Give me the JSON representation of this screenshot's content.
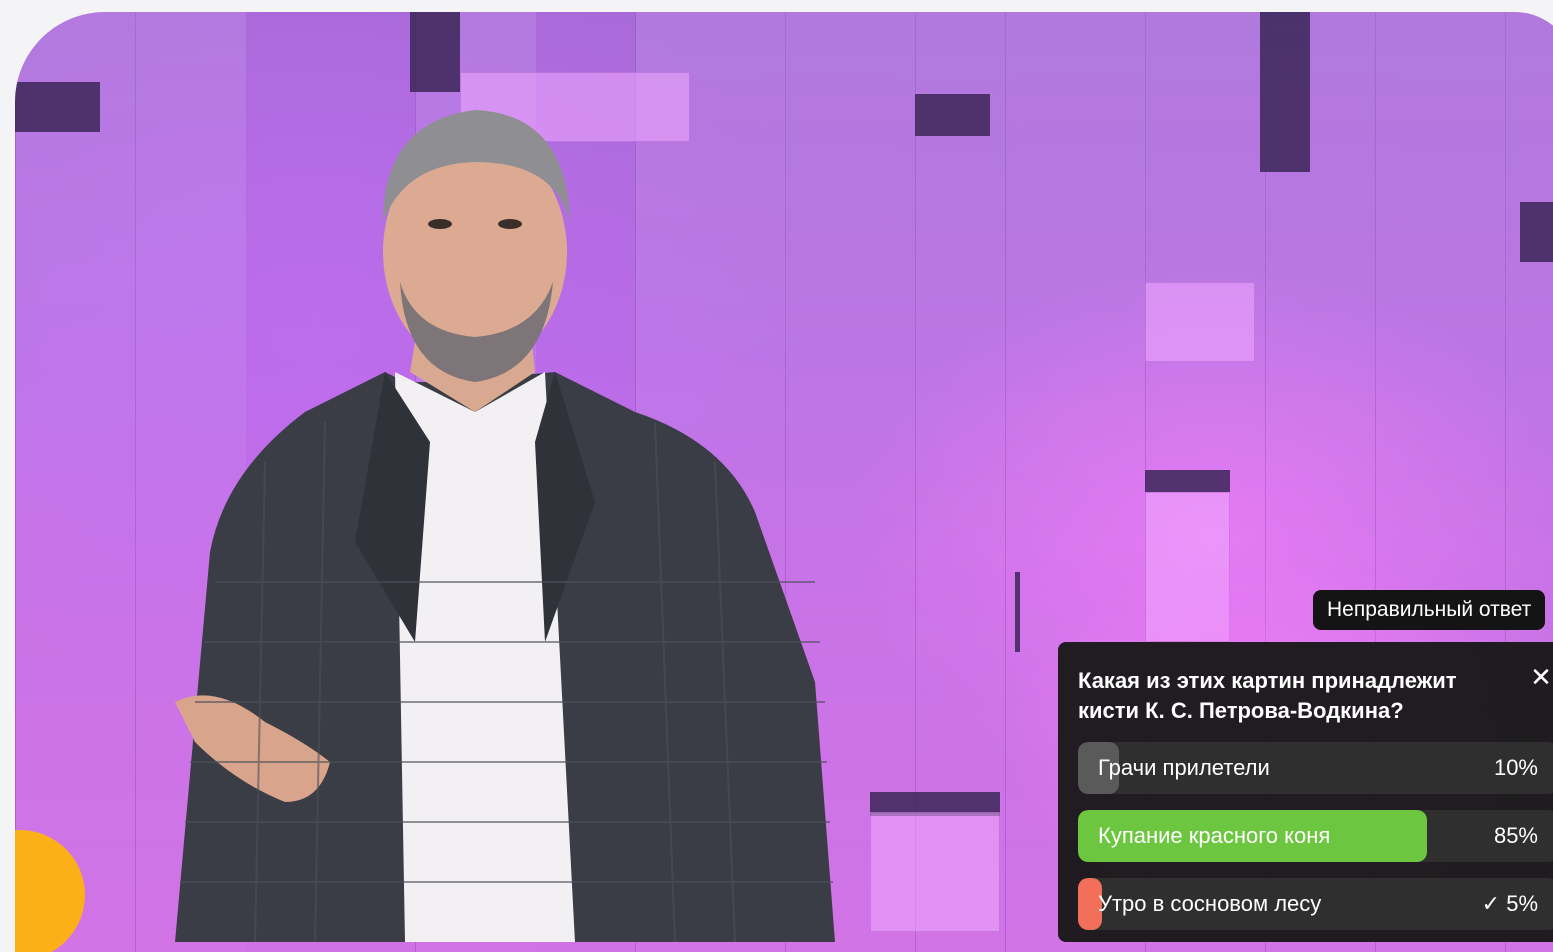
{
  "overlay": {
    "badge_text": "Неправильный ответ"
  },
  "quiz": {
    "question": "Какая из этих картин принадлежит кисти К. С. Петрова-Водкина?",
    "close_icon": "✕",
    "options": [
      {
        "label": "Грачи прилетели",
        "percent": "10%",
        "share": 0.1,
        "color": "#5a5a5a",
        "checked": false
      },
      {
        "label": "Купание красного коня",
        "percent": "85%",
        "share": 0.85,
        "color": "#6cc63f",
        "checked": false
      },
      {
        "label": "Утро в сосновом лесу",
        "percent": "5%",
        "share": 0.05,
        "color": "#f2705a",
        "checked": true,
        "check_icon": "✓"
      }
    ]
  },
  "colors": {
    "correct": "#6cc63f",
    "selected_wrong": "#f2705a",
    "accent_orange": "#fbb017"
  }
}
